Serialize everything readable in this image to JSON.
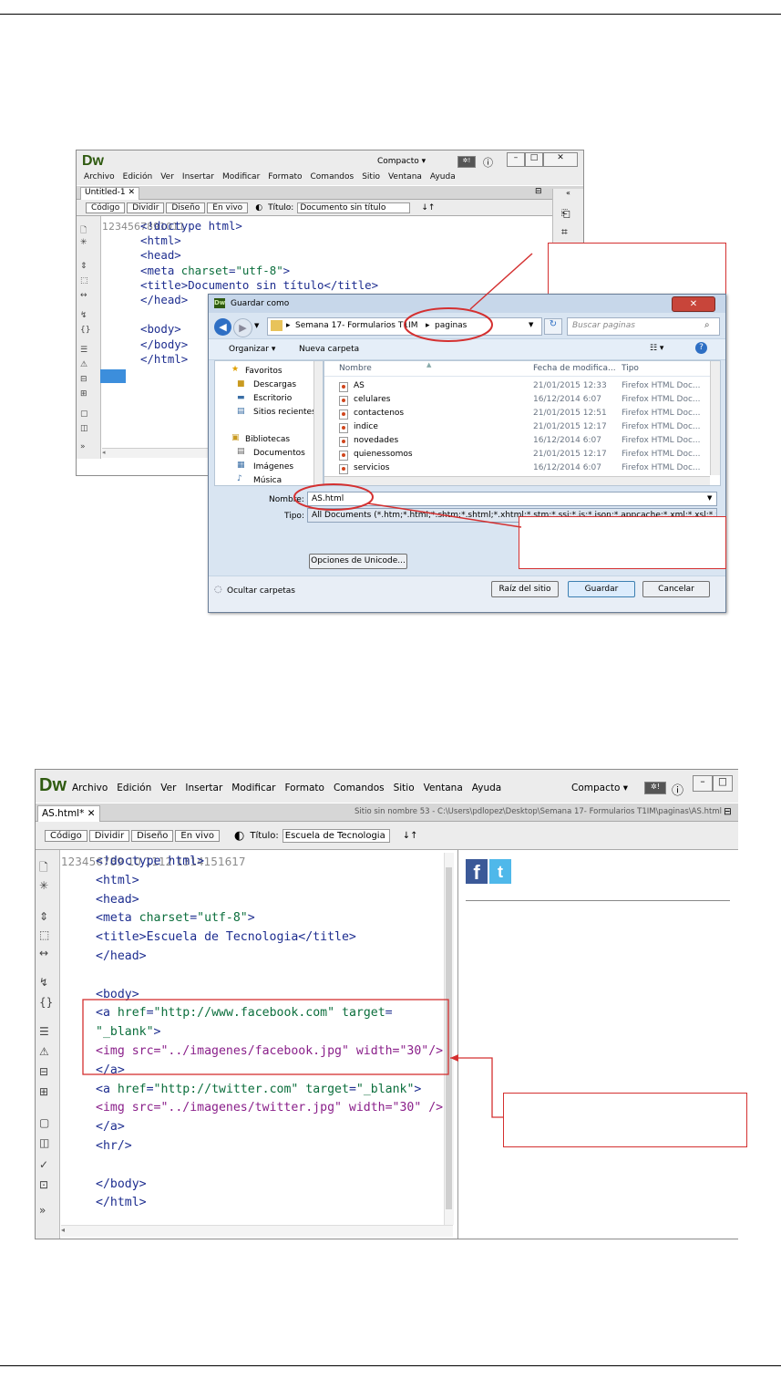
{
  "colors": {
    "accent_red": "#d43030",
    "dw_logo": "#2f5a10",
    "tag_blue": "#1f2f94",
    "attr_green": "#0b6e3c",
    "img_purple": "#8a1f8a"
  },
  "top_window": {
    "logo": "Dw",
    "workspace": "Compacto",
    "menu": [
      "Archivo",
      "Edición",
      "Ver",
      "Insertar",
      "Modificar",
      "Formato",
      "Comandos",
      "Sitio",
      "Ventana",
      "Ayuda"
    ],
    "tab": "Untitled-1",
    "toolbar": {
      "code": "Código",
      "split": "Dividir",
      "design": "Diseño",
      "live": "En vivo",
      "title_label": "Título:",
      "title_value": "Documento sin título"
    },
    "line_numbers": [
      "1",
      "2",
      "3",
      "4",
      "5",
      "6",
      "7",
      "8",
      "9",
      "10",
      "11"
    ],
    "code_lines": [
      "<!doctype html>",
      "<html>",
      "<head>",
      "<meta charset=\"utf-8\">",
      "<title>Documento sin título</title>",
      "</head>",
      "",
      "<body>",
      "</body>",
      "</html>",
      ""
    ]
  },
  "dialog": {
    "title": "Guardar como",
    "breadcrumb": [
      "Semana 17- Formularios T1IM",
      "paginas"
    ],
    "search_placeholder": "Buscar paginas",
    "organize": "Organizar ▾",
    "new_folder": "Nueva carpeta",
    "nav": {
      "favorites": "Favoritos",
      "downloads": "Descargas",
      "desktop": "Escritorio",
      "recent": "Sitios recientes",
      "libraries": "Bibliotecas",
      "documents": "Documentos",
      "images": "Imágenes",
      "music": "Música"
    },
    "columns": {
      "name": "Nombre",
      "date": "Fecha de modifica...",
      "type": "Tipo"
    },
    "files": [
      {
        "name": "AS",
        "date": "21/01/2015 12:33",
        "type": "Firefox HTML Doc..."
      },
      {
        "name": "celulares",
        "date": "16/12/2014 6:07",
        "type": "Firefox HTML Doc..."
      },
      {
        "name": "contactenos",
        "date": "21/01/2015 12:51",
        "type": "Firefox HTML Doc..."
      },
      {
        "name": "indice",
        "date": "21/01/2015 12:17",
        "type": "Firefox HTML Doc..."
      },
      {
        "name": "novedades",
        "date": "16/12/2014 6:07",
        "type": "Firefox HTML Doc..."
      },
      {
        "name": "quienessomos",
        "date": "21/01/2015 12:17",
        "type": "Firefox HTML Doc..."
      },
      {
        "name": "servicios",
        "date": "16/12/2014 6:07",
        "type": "Firefox HTML Doc..."
      }
    ],
    "name_label": "Nombre:",
    "name_value": "AS.html",
    "type_label": "Tipo:",
    "type_value": "All Documents (*.htm;*.html;*.shtm;*.shtml;*.xhtml;*.stm;*.ssi;*.js;*.json;*.appcache;*.xml;*.xsl;*.xsd;",
    "unicode_btn": "Opciones de Unicode...",
    "hide_folders": "Ocultar carpetas",
    "site_root_btn": "Raíz del sitio",
    "save_btn": "Guardar",
    "cancel_btn": "Cancelar"
  },
  "bottom_window": {
    "logo": "Dw",
    "workspace": "Compacto",
    "menu": [
      "Archivo",
      "Edición",
      "Ver",
      "Insertar",
      "Modificar",
      "Formato",
      "Comandos",
      "Sitio",
      "Ventana",
      "Ayuda"
    ],
    "tab": "AS.html*",
    "path": "Sitio sin nombre 53 - C:\\Users\\pdlopez\\Desktop\\Semana 17- Formularios T1IM\\paginas\\AS.html",
    "toolbar": {
      "code": "Código",
      "split": "Dividir",
      "design": "Diseño",
      "live": "En vivo",
      "title_label": "Título:",
      "title_value": "Escuela de Tecnologia"
    },
    "line_numbers": [
      "1",
      "2",
      "3",
      "4",
      "5",
      "6",
      "7",
      "8",
      "9",
      "",
      "10",
      "",
      "11",
      "12",
      "",
      "13",
      "14",
      "15",
      "16",
      "17"
    ],
    "code_lines": [
      "<!doctype html>",
      "<html>",
      "<head>",
      "<meta charset=\"utf-8\">",
      "<title>Escuela de Tecnologia</title>",
      "</head>",
      "",
      "<body>",
      "<a href=\"http://www.facebook.com\" target=",
      "\"_blank\">",
      "<img src=\"../imagenes/facebook.jpg\" width=\"30\"/>",
      "</a>",
      "<a href=\"http://twitter.com\" target=\"_blank\">",
      "<img src=\"../imagenes/twitter.jpg\" width=\"30\" />",
      "</a>",
      "<hr/>",
      "",
      "</body>",
      "</html>",
      ""
    ]
  }
}
